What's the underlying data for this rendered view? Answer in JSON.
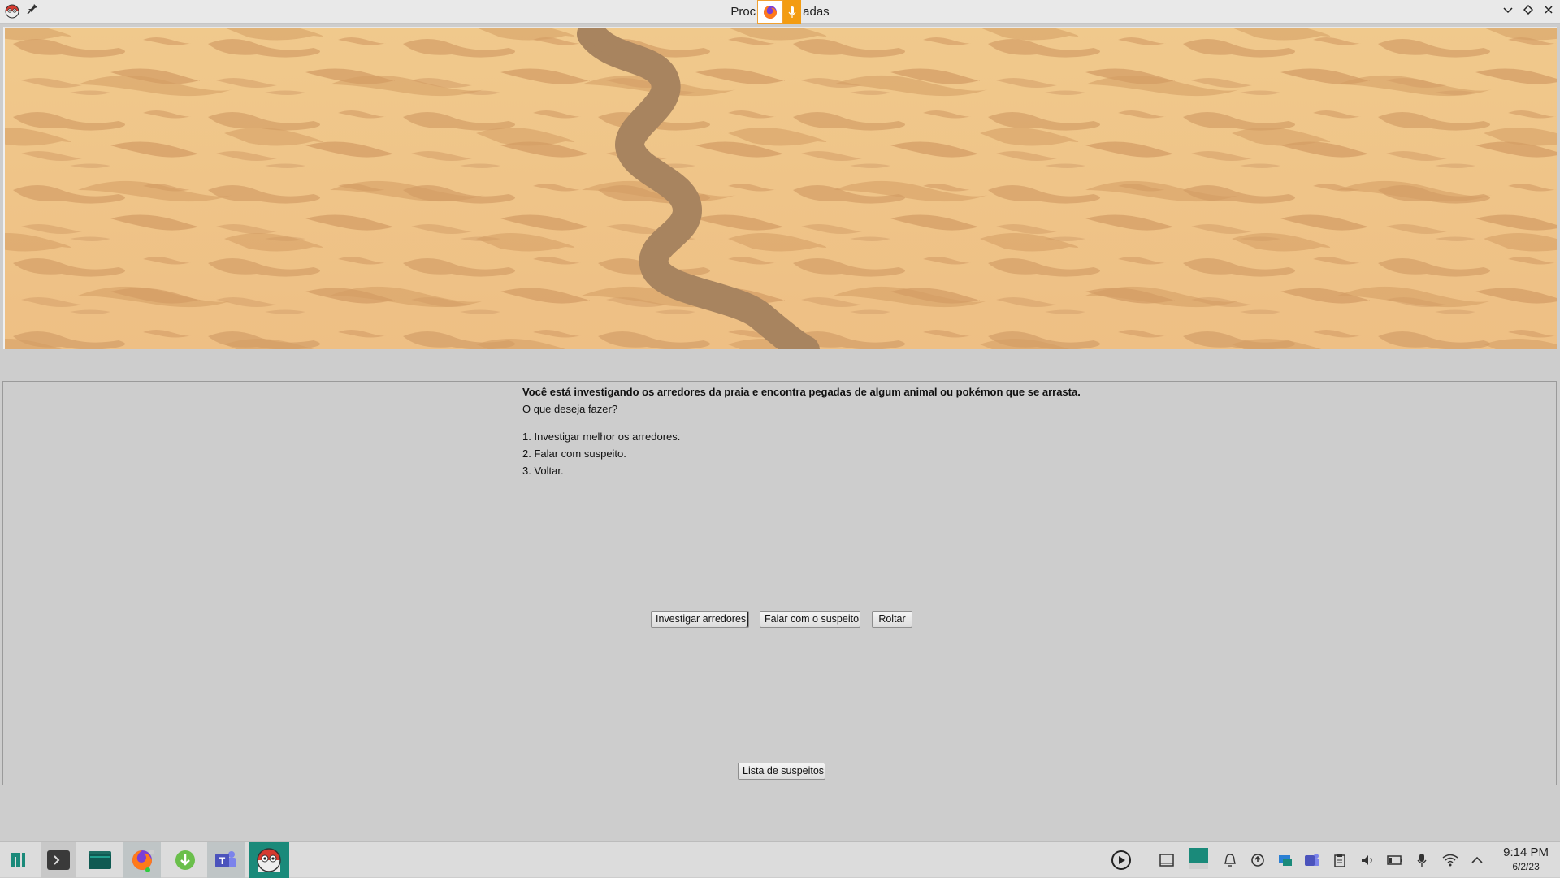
{
  "window": {
    "title_left": "Proc",
    "title_right": "adas",
    "app_icon": "pokeball-face-icon",
    "pin_icon": "pin-icon",
    "controls": [
      "minimize-icon",
      "restore-icon",
      "close-icon"
    ]
  },
  "overlay": {
    "icons": [
      "firefox-icon",
      "microphone-icon"
    ]
  },
  "banner": {
    "description_icon": "sand-texture-with-snake-trail",
    "colors": {
      "sand_light": "#f2c98a",
      "sand_dark": "#d9a36a",
      "trail": "#a88563"
    }
  },
  "story": {
    "intro": "Você está investigando os arredores da praia e encontra pegadas de algum animal ou pokémon que se arrasta.",
    "question": "O que deseja fazer?",
    "options": [
      "1. Investigar melhor os arredores.",
      "2. Falar com suspeito.",
      "3. Voltar."
    ]
  },
  "actions": {
    "investigate": "Investigar arredores",
    "talk": "Falar com o suspeito",
    "back": "Roltar",
    "suspects": "Lista de suspeitos"
  },
  "taskbar": {
    "apps": [
      "menu-icon",
      "terminal-icon",
      "files-icon",
      "firefox-icon",
      "download-icon",
      "teams-icon",
      "pokeball-app-icon"
    ],
    "tray": [
      "media-player-icon",
      "desktop-icon",
      "window-thumbnail-icon",
      "alarm-icon",
      "update-icon",
      "display-icon",
      "teams-tray-icon",
      "clipboard-icon",
      "volume-icon",
      "battery-icon",
      "microphone-icon",
      "wifi-icon",
      "chevron-up-icon"
    ],
    "clock": {
      "time": "9:14 PM",
      "date": "6/2/23"
    },
    "colors": {
      "accent": "#1a8a7a"
    }
  }
}
